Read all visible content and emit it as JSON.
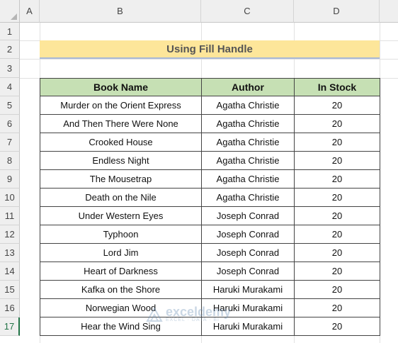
{
  "columns": [
    "A",
    "B",
    "C",
    "D"
  ],
  "rows": [
    "1",
    "2",
    "3",
    "4",
    "5",
    "6",
    "7",
    "8",
    "9",
    "10",
    "11",
    "12",
    "13",
    "14",
    "15",
    "16",
    "17"
  ],
  "title": "Using Fill Handle",
  "table": {
    "headers": [
      "Book Name",
      "Author",
      "In Stock"
    ],
    "rows": [
      {
        "book": "Murder on the Orient Express",
        "author": "Agatha Christie",
        "stock": "20"
      },
      {
        "book": "And Then There Were None",
        "author": "Agatha Christie",
        "stock": "20"
      },
      {
        "book": "Crooked House",
        "author": "Agatha Christie",
        "stock": "20"
      },
      {
        "book": "Endless Night",
        "author": "Agatha Christie",
        "stock": "20"
      },
      {
        "book": "The Mousetrap",
        "author": "Agatha Christie",
        "stock": "20"
      },
      {
        "book": "Death on the Nile",
        "author": "Agatha Christie",
        "stock": "20"
      },
      {
        "book": "Under Western Eyes",
        "author": "Joseph Conrad",
        "stock": "20"
      },
      {
        "book": "Typhoon",
        "author": "Joseph Conrad",
        "stock": "20"
      },
      {
        "book": "Lord Jim",
        "author": "Joseph Conrad",
        "stock": "20"
      },
      {
        "book": "Heart of Darkness",
        "author": "Joseph Conrad",
        "stock": "20"
      },
      {
        "book": "Kafka on the Shore",
        "author": "Haruki Murakami",
        "stock": "20"
      },
      {
        "book": "Norwegian Wood",
        "author": "Haruki Murakami",
        "stock": "20"
      },
      {
        "book": "Hear the Wind Sing",
        "author": "Haruki Murakami",
        "stock": "20"
      }
    ]
  },
  "watermark": {
    "name": "exceldemy",
    "tagline": "EXCEL · DATA · BI"
  },
  "colors": {
    "title_fill": "#fde69a",
    "header_fill": "#c6e0b4",
    "selected_row": "#217346"
  }
}
